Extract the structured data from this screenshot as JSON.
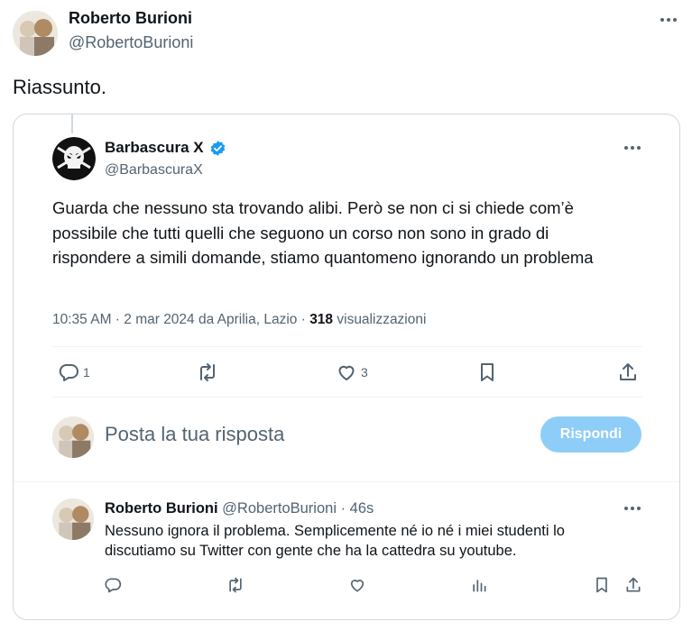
{
  "tweet": {
    "author_name": "Roberto Burioni",
    "author_handle": "@RobertoBurioni",
    "text": "Riassunto."
  },
  "quoted": {
    "author_name": "Barbascura X",
    "author_handle": "@BarbascuraX",
    "text": "Guarda che nessuno sta trovando alibi. Però se non ci si chiede com’è possibile che tutti quelli che seguono un corso non sono in grado di rispondere a simili domande, stiamo quantomeno ignorando un problema",
    "meta_time": "10:35 AM · 2 mar 2024 da Aprilia, Lazio · ",
    "views_count": "318",
    "views_label": " visualizzazioni",
    "replies_count": "1",
    "likes_count": "3"
  },
  "compose": {
    "placeholder": "Posta la tua risposta",
    "button_label": "Rispondi"
  },
  "reply": {
    "author_name": "Roberto Burioni",
    "author_handle": "@RobertoBurioni",
    "time": " · 46s",
    "text": "Nessuno ignora il problema. Semplicemente né io né i miei studenti lo discutiamo su Twitter con gente che ha la cattedra su youtube."
  },
  "colors": {
    "accent": "#1d9bf0",
    "button_disabled": "#8ecdf8",
    "verified": "#1d9bf0"
  },
  "icons": [
    "more-icon",
    "verified-badge-icon",
    "reply-icon",
    "retweet-icon",
    "like-icon",
    "bookmark-icon",
    "share-icon",
    "views-icon"
  ]
}
